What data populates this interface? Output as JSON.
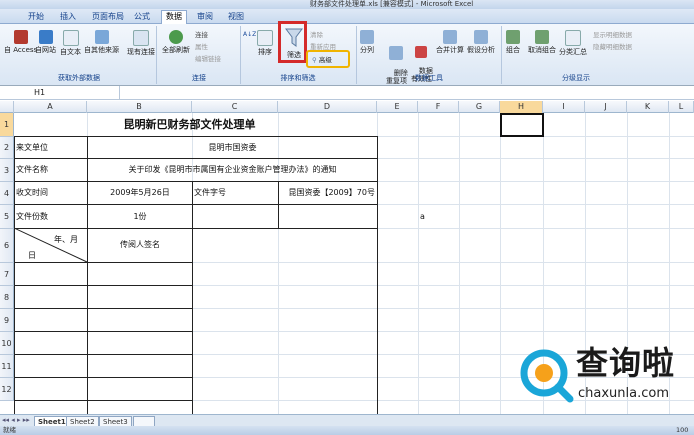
{
  "window": {
    "title": "财务部文件处理单.xls [兼容模式] - Microsoft Excel"
  },
  "tabs": [
    "开始",
    "插入",
    "页面布局",
    "公式",
    "数据",
    "审阅",
    "视图"
  ],
  "active_tab": "数据",
  "ribbon": {
    "groups": {
      "external": "获取外部数据",
      "connections": "连接",
      "sort_filter": "排序和筛选",
      "data_tools": "数据工具",
      "outline": "分级显示"
    },
    "buttons": {
      "access": "自 Access",
      "web": "自网站",
      "text": "自文本",
      "other": "自其他来源",
      "existing": "现有连接",
      "refresh": "全部刷新",
      "connections": "连接",
      "properties": "属性",
      "edit_links": "编辑链接",
      "sort": "排序",
      "filter": "筛选",
      "clear": "清除",
      "reapply": "重新应用",
      "advanced": "高级",
      "split": "分列",
      "dedupe": "删除\n重复项",
      "validation": "数据\n有效性",
      "consolidate": "合并计算",
      "whatif": "假设分析",
      "group": "组合",
      "ungroup": "取消组合",
      "subtotal": "分类汇总",
      "show_detail": "显示明细数据",
      "hide_detail": "隐藏明细数据"
    }
  },
  "namebox": "H1",
  "columns": [
    "A",
    "B",
    "C",
    "D",
    "E",
    "F",
    "G",
    "H",
    "I",
    "J",
    "K",
    "L"
  ],
  "rows": [
    "1",
    "2",
    "3",
    "4",
    "5",
    "6",
    "7",
    "8",
    "9",
    "10",
    "11",
    "12"
  ],
  "sheet": {
    "title": "昆明新巴财务部文件处理单",
    "r2_label": "来文单位",
    "r2_value": "昆明市国资委",
    "r3_label": "文件名称",
    "r3_value": "关于印发《昆明市市属国有企业资金账户管理办法》的通知",
    "r4_label": "收文时间",
    "r4_date": "2009年5月26日",
    "r4_doc_label": "文件字号",
    "r4_doc_value": "昆国资委【2009】70号",
    "r5_label": "文件份数",
    "r5_value": "1份",
    "f5_value": "a",
    "diag_top": "年、月",
    "diag_bottom": "日",
    "circulate": "传阅人签名"
  },
  "sheet_tabs": [
    "Sheet1",
    "Sheet2",
    "Sheet3"
  ],
  "status": "就绪",
  "zoom": "100",
  "watermark": {
    "text": "查询啦",
    "url": "chaxunla.com"
  }
}
